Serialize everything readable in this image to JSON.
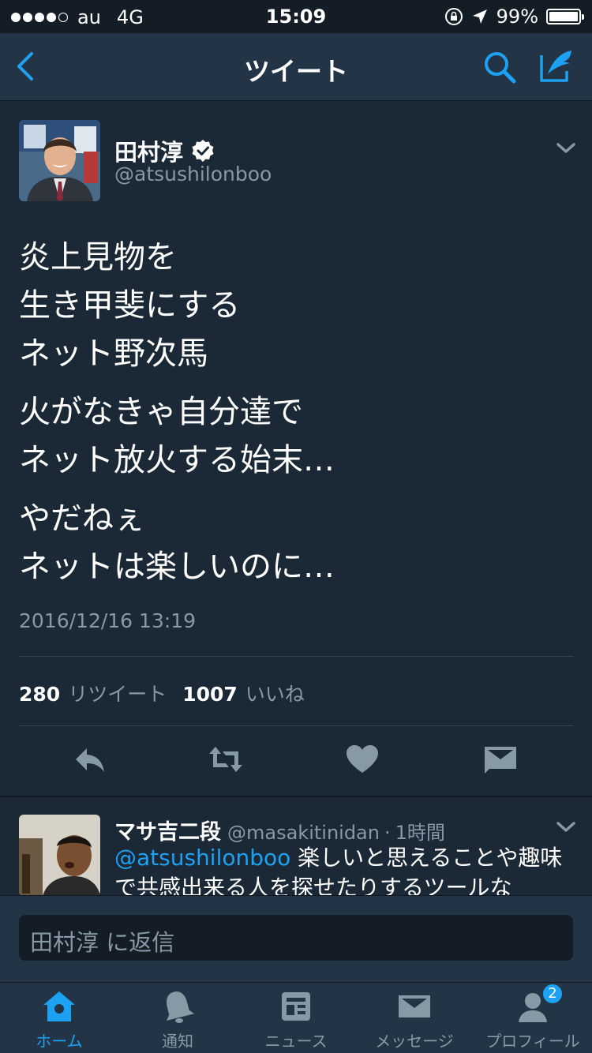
{
  "status_bar": {
    "carrier": "au",
    "network": "4G",
    "time": "15:09",
    "battery": "99%",
    "battery_level": 0.99
  },
  "nav": {
    "title": "ツイート",
    "back_icon": "chevron-left-icon",
    "search_icon": "search-icon",
    "compose_icon": "compose-icon",
    "accent": "#1da1f2"
  },
  "tweet": {
    "author_name": "田村淳",
    "verified": true,
    "handle": "@atsushilonboo",
    "paragraphs": [
      [
        "炎上見物を",
        "生き甲斐にする",
        "ネット野次馬"
      ],
      [
        "火がなきゃ自分達で",
        "ネット放火する始末…"
      ],
      [
        "やだねぇ",
        "ネットは楽しいのに…"
      ]
    ],
    "timestamp": "2016/12/16 13:19",
    "retweet_count": "280",
    "retweet_label": "リツイート",
    "like_count": "1007",
    "like_label": "いいね",
    "actions": [
      "reply-icon",
      "retweet-icon",
      "heart-icon",
      "direct-message-icon"
    ]
  },
  "reply": {
    "author_name": "マサ吉二段",
    "handle": "@masakitinidan",
    "separator": "·",
    "time": "1時間",
    "mention": "@atsushilonboo",
    "text": " 楽しいと思えることや趣味で共感出来る人を探せたりするツールな"
  },
  "reply_input": {
    "placeholder": "田村淳 に返信"
  },
  "tabs": [
    {
      "label": "ホーム",
      "icon": "home-icon",
      "active": true
    },
    {
      "label": "通知",
      "icon": "bell-icon",
      "active": false
    },
    {
      "label": "ニュース",
      "icon": "news-icon",
      "active": false
    },
    {
      "label": "メッセージ",
      "icon": "envelope-icon",
      "active": false
    },
    {
      "label": "プロフィール",
      "icon": "profile-icon",
      "active": false,
      "badge": "2"
    }
  ]
}
